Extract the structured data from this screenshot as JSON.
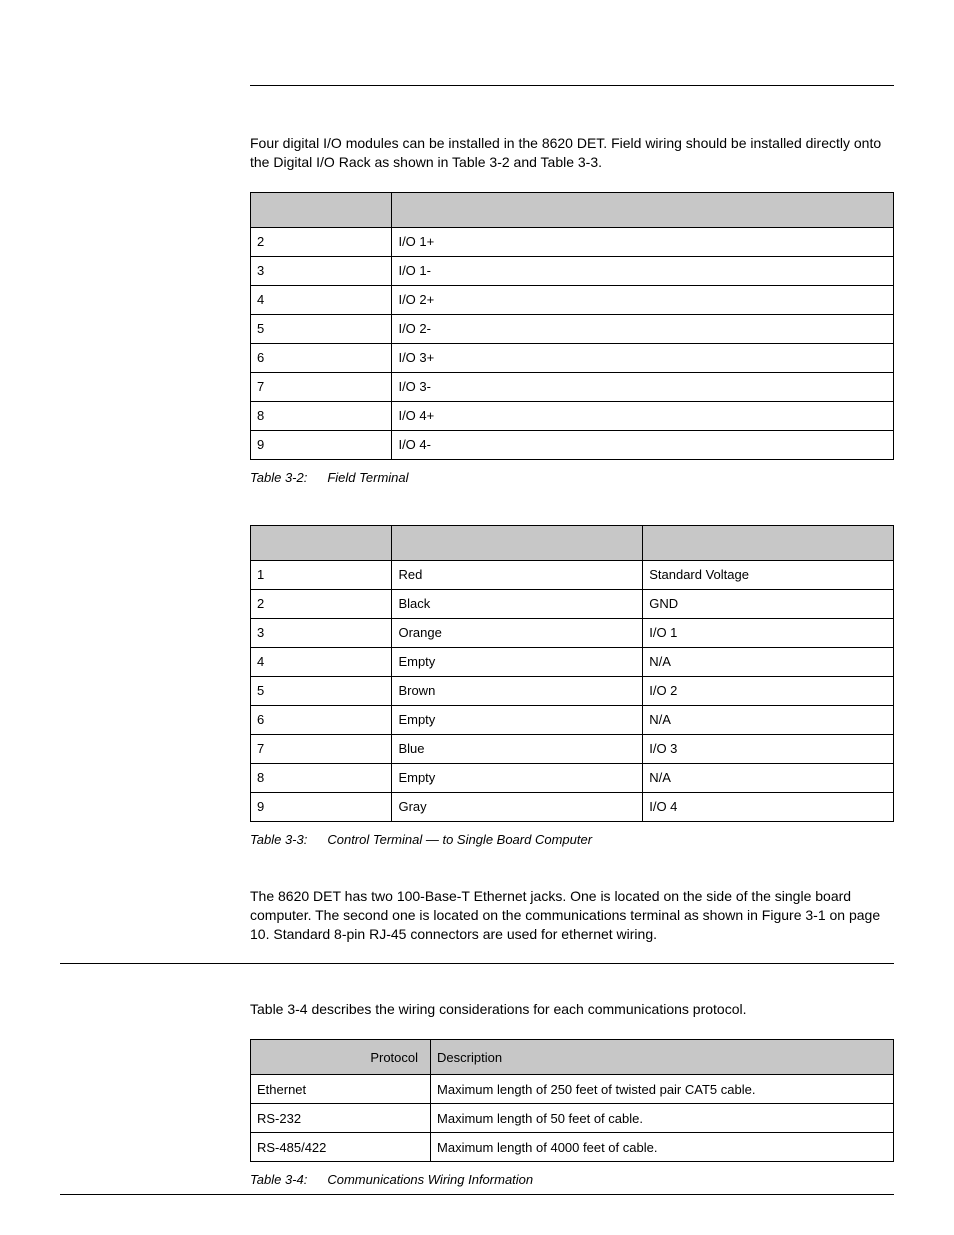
{
  "intro_paragraph": "Four digital I/O modules can be installed in the 8620 DET. Field wiring should be installed directly onto the Digital I/O Rack as shown in Table 3-2 and Table 3-3.",
  "table32": {
    "rows": [
      {
        "c0": "2",
        "c1": "I/O 1+"
      },
      {
        "c0": "3",
        "c1": "I/O 1-"
      },
      {
        "c0": "4",
        "c1": "I/O 2+"
      },
      {
        "c0": "5",
        "c1": "I/O 2-"
      },
      {
        "c0": "6",
        "c1": "I/O 3+"
      },
      {
        "c0": "7",
        "c1": "I/O 3-"
      },
      {
        "c0": "8",
        "c1": "I/O 4+"
      },
      {
        "c0": "9",
        "c1": "I/O 4-"
      }
    ],
    "caption_label": "Table 3-2:",
    "caption_text": "Field Terminal"
  },
  "table33": {
    "rows": [
      {
        "c0": "1",
        "c1": "Red",
        "c2": "Standard Voltage"
      },
      {
        "c0": "2",
        "c1": "Black",
        "c2": "GND"
      },
      {
        "c0": "3",
        "c1": "Orange",
        "c2": "I/O 1"
      },
      {
        "c0": "4",
        "c1": "Empty",
        "c2": "N/A"
      },
      {
        "c0": "5",
        "c1": "Brown",
        "c2": "I/O 2"
      },
      {
        "c0": "6",
        "c1": "Empty",
        "c2": "N/A"
      },
      {
        "c0": "7",
        "c1": "Blue",
        "c2": "I/O 3"
      },
      {
        "c0": "8",
        "c1": "Empty",
        "c2": "N/A"
      },
      {
        "c0": "9",
        "c1": "Gray",
        "c2": "I/O 4"
      }
    ],
    "caption_label": "Table 3-3:",
    "caption_text": "Control Terminal — to Single Board Computer"
  },
  "ethernet_paragraph": "The 8620 DET has two 100-Base-T Ethernet jacks. One is located on the side of the single board computer. The second one is located on the communications terminal as shown in Figure 3-1 on page 10. Standard 8-pin RJ-45 connectors are used for ethernet wiring.",
  "wiring_intro": "Table 3-4 describes the wiring considerations for each communications protocol.",
  "table34": {
    "header": {
      "h0": "Protocol",
      "h1": "Description"
    },
    "rows": [
      {
        "c0": "Ethernet",
        "c1": "Maximum length of 250 feet of twisted pair CAT5 cable."
      },
      {
        "c0": "RS-232",
        "c1": "Maximum length of 50 feet of cable."
      },
      {
        "c0": "RS-485/422",
        "c1": "Maximum length of 4000 feet of cable."
      }
    ],
    "caption_label": "Table 3-4:",
    "caption_text": "Communications Wiring Information"
  }
}
